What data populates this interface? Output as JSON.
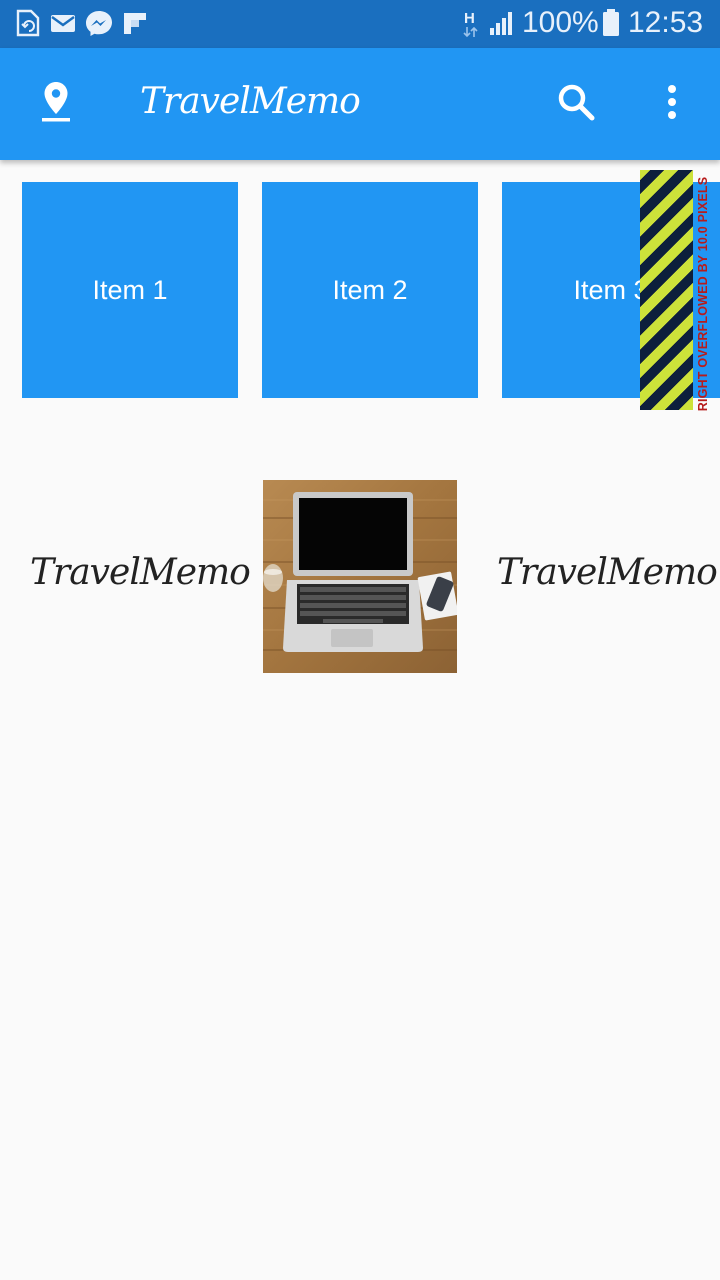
{
  "status_bar": {
    "battery": "100%",
    "time": "12:53",
    "network_type": "H",
    "notification_icons": [
      "sim-update-icon",
      "mail-icon",
      "messenger-icon",
      "flipboard-icon"
    ]
  },
  "app_bar": {
    "title": "TravelMemo",
    "leading_icon": "location-pin-icon",
    "actions": [
      "search-icon",
      "more-vert-icon"
    ]
  },
  "items": [
    {
      "label": "Item 1"
    },
    {
      "label": "Item 2"
    },
    {
      "label": "Item 3"
    }
  ],
  "overflow_warning": {
    "text": "RIGHT OVERFLOWED BY 10.0 PIXELS"
  },
  "logo_row": {
    "left_logo": "TravelMemo",
    "right_logo": "TravelMemo",
    "image_subject": "laptop-on-wooden-desk"
  },
  "colors": {
    "primary": "#2196f3",
    "status_bar": "#1a6fbf",
    "background": "#fafafa",
    "overflow_warning": "#b71c1c"
  }
}
